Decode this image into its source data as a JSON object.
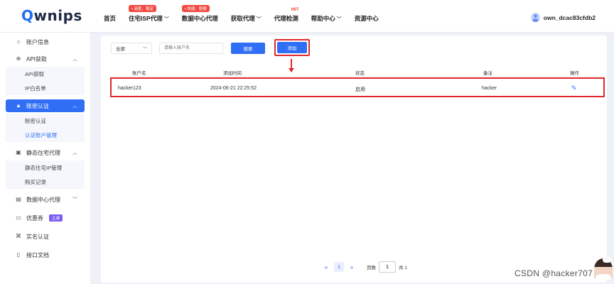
{
  "logo": {
    "brand_tail": "wnips",
    "brand_q": "Q"
  },
  "nav": {
    "items": [
      {
        "label": "首页"
      },
      {
        "label": "住宅ISP代理",
        "badge": "• 高匿、稳定"
      },
      {
        "label": "数据中心代理",
        "badge": "• 快捷、便捷"
      },
      {
        "label": "获取代理"
      },
      {
        "label": "代理检测",
        "hot": "HOT"
      },
      {
        "label": "帮助中心"
      },
      {
        "label": "资源中心"
      }
    ]
  },
  "user": {
    "name": "own_dcac83cfdb2"
  },
  "sidebar": {
    "account_info": "账户信息",
    "api_get": "API获取",
    "api_get_sub": "API获取",
    "ip_whitelist": "IP白名单",
    "account_auth": "账密认证",
    "account_auth_sub": "账密认证",
    "auth_account_mgmt": "认证账户管理",
    "static_residential": "静态住宅代理",
    "static_ip_mgmt": "静态住宅IP管理",
    "purchase_records": "购买记录",
    "datacenter_proxy": "数据中心代理",
    "coupons": "优惠券",
    "coupon_tag": "立减",
    "real_name": "实名认证",
    "api_docs": "接口文档"
  },
  "filter": {
    "select_value": "全部",
    "input_placeholder": "请输入账户名",
    "search_label": "搜索",
    "add_label": "添加"
  },
  "table": {
    "headers": [
      "账户名",
      "添加时间",
      "状态",
      "备注",
      "操作"
    ],
    "rows": [
      {
        "account": "hacker123",
        "added": "2024-06-21 22:25:52",
        "status": "启用",
        "note": "hacker"
      }
    ]
  },
  "pager": {
    "prev": "«",
    "current": "1",
    "next": "»",
    "page_label": "页数",
    "input_value": "1",
    "total": "共 1"
  },
  "watermark": "CSDN @hacker707",
  "colors": {
    "accent": "#2f6ef5",
    "highlight": "#e0282c",
    "badge": "#f04a41"
  }
}
